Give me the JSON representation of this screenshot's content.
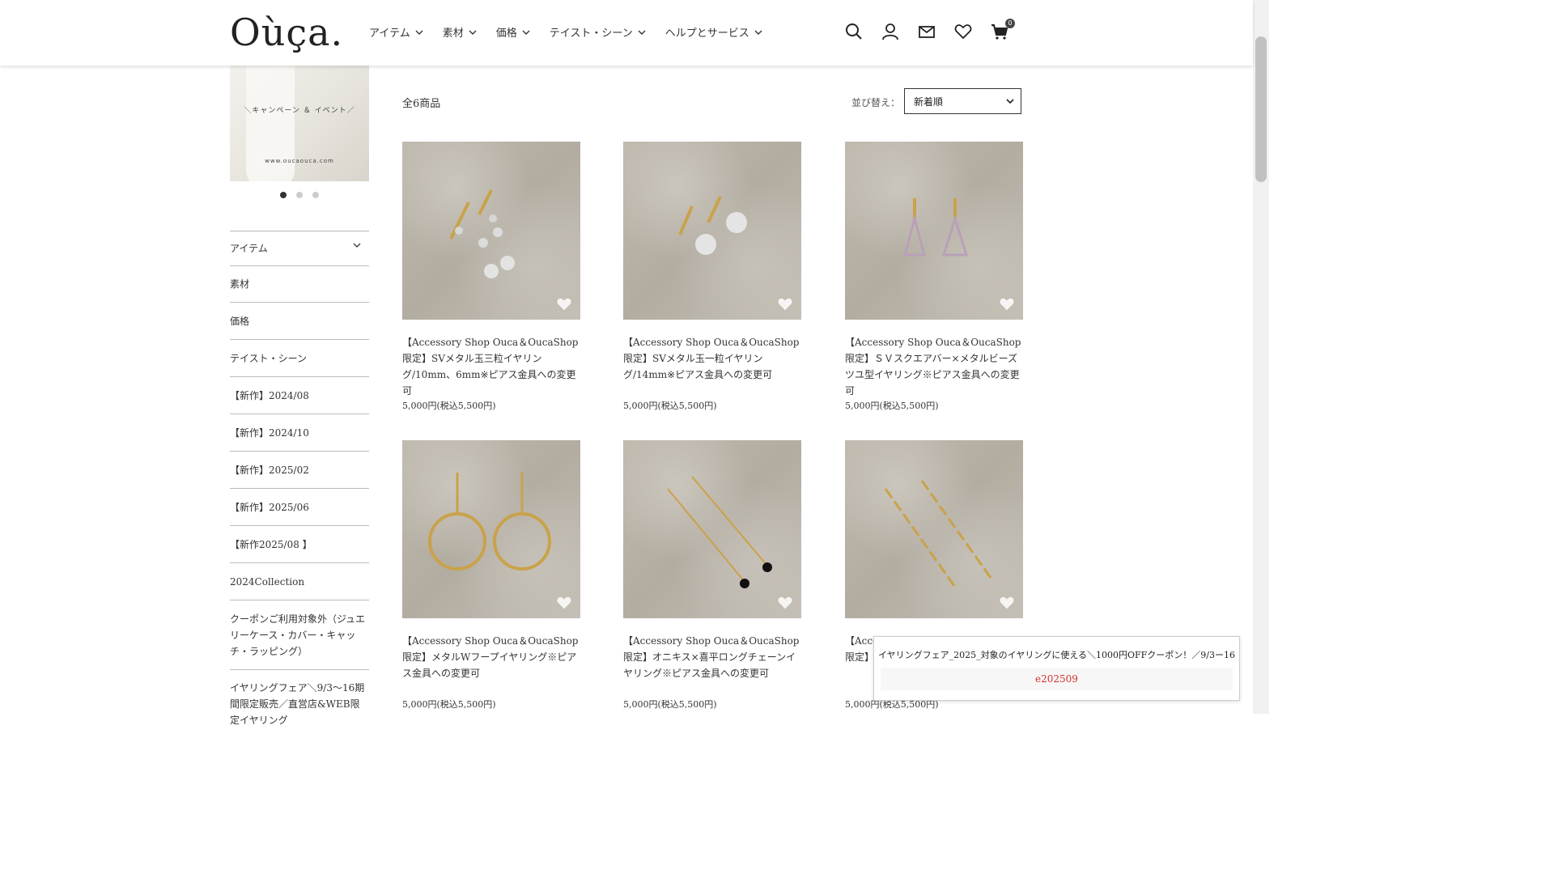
{
  "header": {
    "logo": "Oùça.",
    "nav": [
      "アイテム",
      "素材",
      "価格",
      "テイスト・シーン",
      "ヘルプとサービス"
    ],
    "cart_count": "0"
  },
  "banner": {
    "text": "＼キャンペーン ＆ イベント／",
    "url": "www.oucaouca.com"
  },
  "sidebar": {
    "items": [
      "アイテム",
      "素材",
      "価格",
      "テイスト・シーン",
      "【新作】2024/08",
      "【新作】2024/10",
      "【新作】2025/02",
      "【新作】2025/06",
      "【新作2025/08 】",
      "2024Collection",
      "クーポンご利用対象外（ジュエリーケース・カバー・キャッチ・ラッピング）",
      "イヤリングフェア＼9/3〜16期間限定販売／直営店&WEB限定イヤリング"
    ]
  },
  "main": {
    "count": "全6商品",
    "sort_label": "並び替え：",
    "sort_value": "新着順"
  },
  "products": [
    {
      "title": "【Accessory Shop Ouca＆OucaShop限定】SVメタル玉三粒イヤリング/10mm、6mm※ピアス金具への変更可",
      "price": "5,000円(税込5,500円)"
    },
    {
      "title": "【Accessory Shop Ouca＆OucaShop限定】SVメタル玉一粒イヤリング/14mm※ピアス金具への変更可",
      "price": "5,000円(税込5,500円)"
    },
    {
      "title": "【Accessory Shop Ouca＆OucaShop限定】ＳＶスクエアバー×メタルビーズツユ型イヤリング※ピアス金具への変更可",
      "price": "5,000円(税込5,500円)"
    },
    {
      "title": "【Accessory Shop Ouca＆OucaShop限定】メタルWフープイヤリング※ピアス金具への変更可",
      "price": "5,000円(税込5,500円)"
    },
    {
      "title": "【Accessory Shop Ouca＆OucaShop限定】オニキス×喜平ロングチェーンイヤリング※ピアス金具への変更可",
      "price": "5,000円(税込5,500円)"
    },
    {
      "title": "【Accessory Shop Ouca＆OucaShop限定】パ…リング",
      "price": "5,000円(税込5,500円)"
    }
  ],
  "coupon": {
    "text": "イヤリングフェア_2025_対象のイヤリングに使える＼1000円OFFクーポン！／9/3ー16",
    "code": "e202509"
  }
}
